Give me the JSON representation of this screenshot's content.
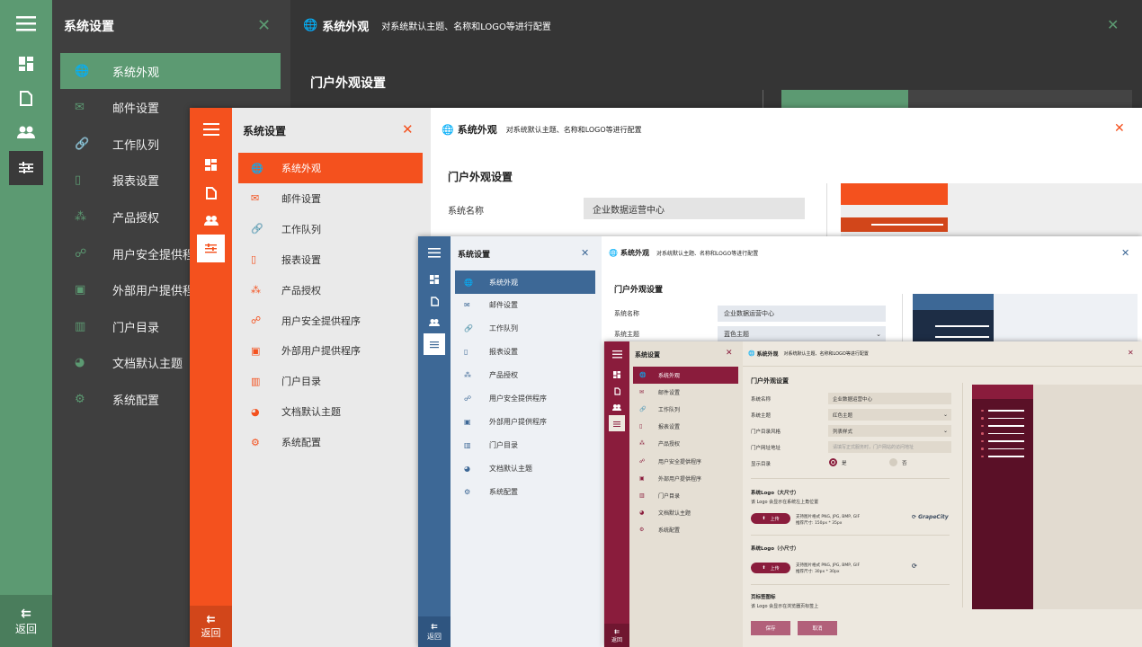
{
  "nav": {
    "title": "系统设置",
    "items": [
      "系统外观",
      "邮件设置",
      "工作队列",
      "报表设置",
      "产品授权",
      "用户安全提供程序",
      "外部用户提供程序",
      "门户目录",
      "文档默认主题",
      "系统配置"
    ]
  },
  "rail": {
    "back_label": "返回"
  },
  "header": {
    "title": "系统外观",
    "desc": "对系统默认主题、名称和LOGO等进行配置"
  },
  "section": {
    "portal_title": "门户外观设置"
  },
  "form": {
    "name_label": "系统名称",
    "name_value": "企业数据运营中心",
    "theme_label": "系统主题",
    "theme_blue": "蓝色主题",
    "theme_red": "红色主题",
    "menu_style_label": "门户目录风格",
    "menu_style_value": "列表样式",
    "url_label": "门户网址地址",
    "url_placeholder": "请填写正式服务时，门户网站的访问地址",
    "show_label": "显示目录",
    "yes": "是",
    "no": "否",
    "logo_large_title": "系统Logo（大尺寸）",
    "logo_large_desc": "该 Logo 会显示在系统左上角位置",
    "upload": "上传",
    "logo_large_hint1": "支持图片格式 PNG, JPG, BMP, GIF",
    "logo_large_hint2": "推荐尺寸: 150px * 35px",
    "logo_brand": "GrapeCity",
    "logo_small_title": "系统Logo（小尺寸）",
    "logo_small_hint1": "支持图片格式 PNG, JPG, BMP, GIF",
    "logo_small_hint2": "推荐尺寸: 30px * 30px",
    "favicon_title": "页标签图标",
    "favicon_desc": "该 Logo 会显示在浏览器页标签上",
    "save": "保存",
    "cancel": "取消"
  },
  "colors": {
    "green": "#5c9a72",
    "orange": "#f4511e",
    "blue": "#3d6896",
    "maroon": "#8a1c3c"
  }
}
